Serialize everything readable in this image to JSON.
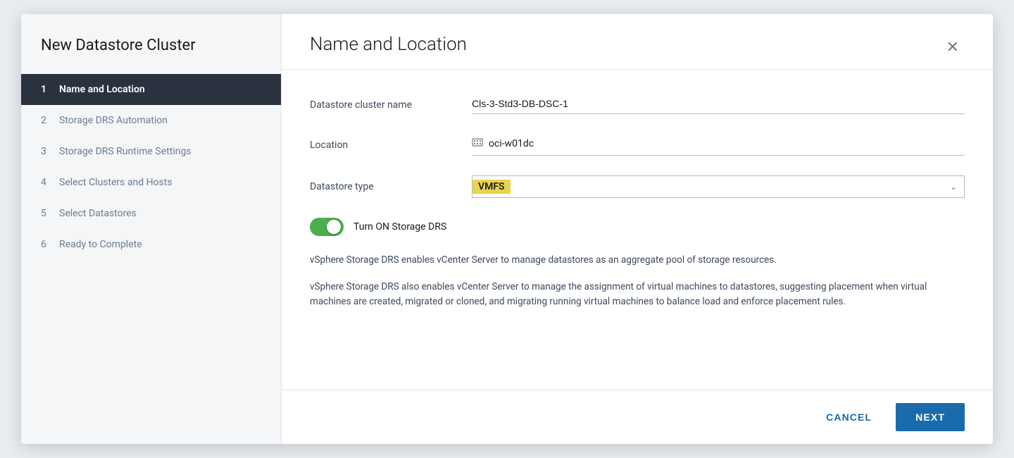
{
  "sidebar": {
    "title": "New Datastore Cluster",
    "steps": [
      {
        "num": "1",
        "label": "Name and Location",
        "active": true
      },
      {
        "num": "2",
        "label": "Storage DRS Automation",
        "active": false
      },
      {
        "num": "3",
        "label": "Storage DRS Runtime Settings",
        "active": false
      },
      {
        "num": "4",
        "label": "Select Clusters and Hosts",
        "active": false
      },
      {
        "num": "5",
        "label": "Select Datastores",
        "active": false
      },
      {
        "num": "6",
        "label": "Ready to Complete",
        "active": false
      }
    ]
  },
  "main": {
    "title": "Name and Location",
    "form": {
      "datastore_cluster_name_label": "Datastore cluster name",
      "datastore_cluster_name_value": "Cls-3-Std3-DB-DSC-1",
      "location_label": "Location",
      "location_value": "oci-w01dc",
      "datastore_type_label": "Datastore type",
      "datastore_type_value": "VMFS",
      "toggle_label": "Turn ON Storage DRS",
      "description1": "vSphere Storage DRS enables vCenter Server to manage datastores as an aggregate pool of storage resources.",
      "description2": "vSphere Storage DRS also enables vCenter Server to manage the assignment of virtual machines to datastores, suggesting placement when virtual machines are created, migrated or cloned, and migrating running virtual machines to balance load and enforce placement rules."
    },
    "footer": {
      "cancel_label": "CANCEL",
      "next_label": "NEXT"
    }
  }
}
